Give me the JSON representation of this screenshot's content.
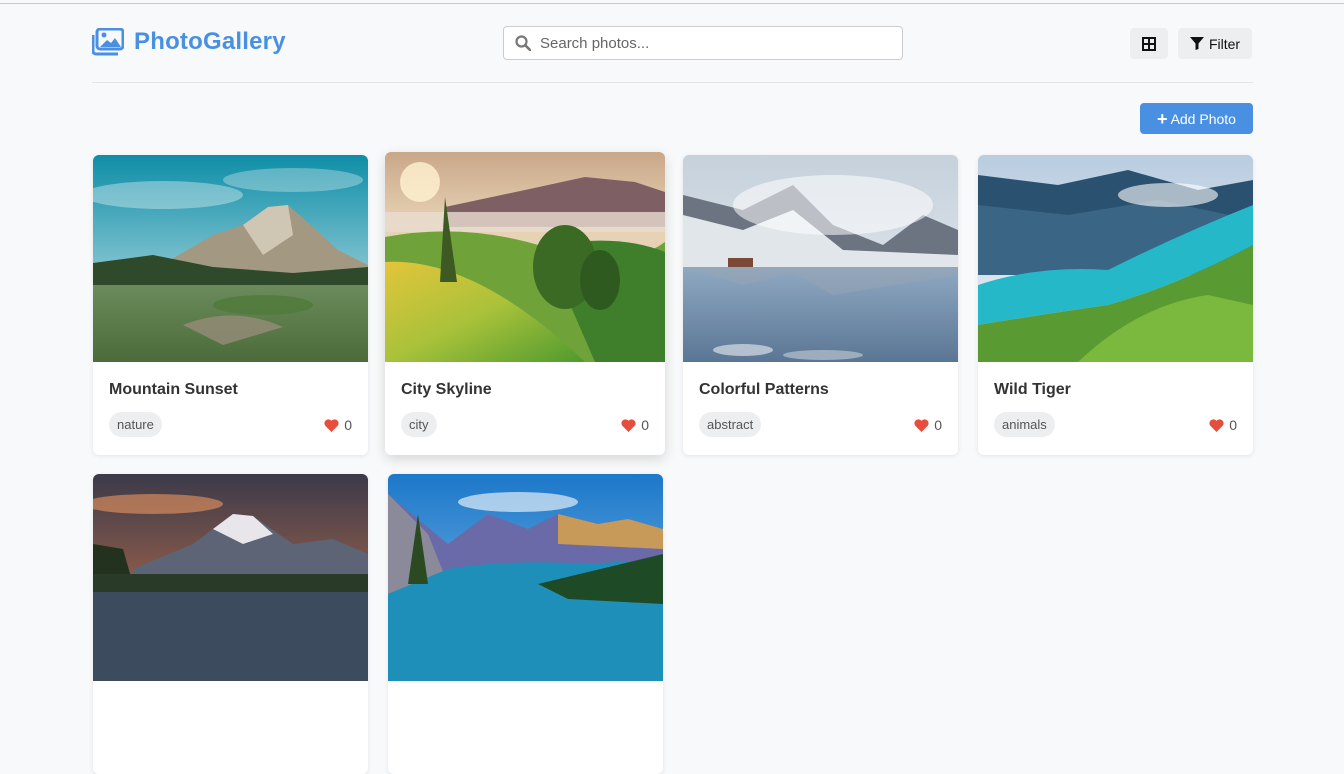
{
  "header": {
    "logo_text": "PhotoGallery",
    "logo_icon": "images-icon",
    "search": {
      "placeholder": "Search photos...",
      "value": "",
      "icon": "search-icon"
    },
    "grid_view_icon": "grid-icon",
    "filter_label": "Filter",
    "filter_icon": "funnel-icon"
  },
  "toolbar": {
    "add_label": "Add Photo",
    "add_icon": "plus-icon"
  },
  "colors": {
    "accent": "#4a90e2",
    "heart": "#e74c3c",
    "background": "#f8f9fa"
  },
  "photos": [
    {
      "title": "Mountain Sunset",
      "tag": "nature",
      "likes": "0"
    },
    {
      "title": "City Skyline",
      "tag": "city",
      "likes": "0"
    },
    {
      "title": "Colorful Patterns",
      "tag": "abstract",
      "likes": "0"
    },
    {
      "title": "Wild Tiger",
      "tag": "animals",
      "likes": "0"
    },
    {
      "title": "",
      "tag": "",
      "likes": ""
    },
    {
      "title": "",
      "tag": "",
      "likes": ""
    }
  ]
}
